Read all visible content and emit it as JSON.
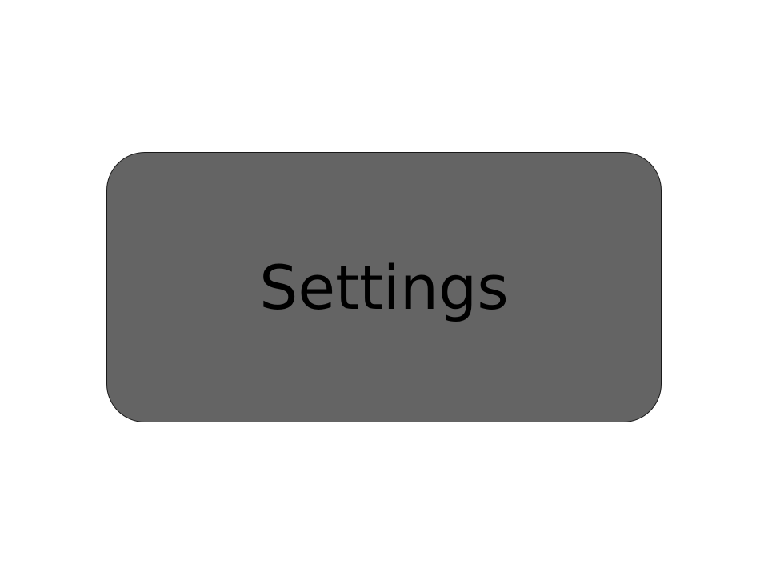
{
  "settings_button": {
    "label": "Settings",
    "background_color": "#646464",
    "border_color": "#1a1a1a",
    "text_color": "#000000"
  },
  "page": {
    "background_color": "#ffffff"
  }
}
